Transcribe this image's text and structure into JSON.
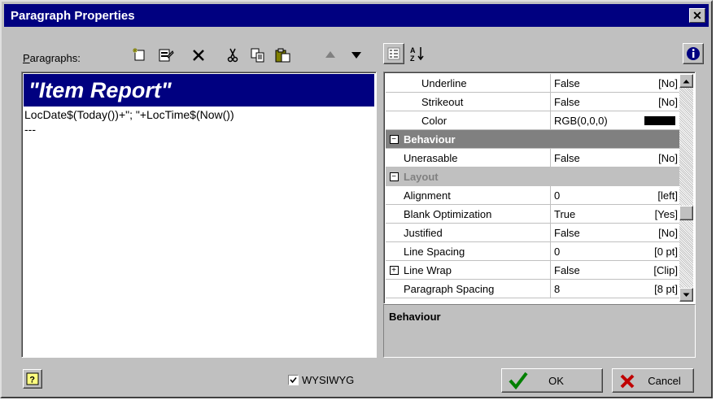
{
  "window": {
    "title": "Paragraph Properties",
    "close_glyph": "✕"
  },
  "paragraphs": {
    "label_prefix": "",
    "label_accel": "P",
    "label_rest": "aragraphs:",
    "items": [
      {
        "text": "\"Item Report\"",
        "selected": true
      },
      {
        "text": "LocDate$(Today())+\"; \"+LocTime$(Now())",
        "selected": false
      },
      {
        "text": "---",
        "selected": false
      }
    ]
  },
  "toolbar": {
    "icons": [
      "new-paragraph-icon",
      "properties-icon",
      "delete-icon",
      "cut-icon",
      "copy-icon",
      "paste-icon",
      "move-up-icon",
      "move-down-icon"
    ],
    "grid_icons": [
      "categorized-view-icon",
      "sort-alphabetical-icon",
      "info-icon"
    ]
  },
  "properties": {
    "rows": [
      {
        "kind": "prop",
        "name": "Underline",
        "value": "False",
        "extra": "[No]"
      },
      {
        "kind": "prop",
        "name": "Strikeout",
        "value": "False",
        "extra": "[No]"
      },
      {
        "kind": "prop",
        "name": "Color",
        "value": "RGB(0,0,0)",
        "extra": "",
        "swatch": "#000000"
      },
      {
        "kind": "category",
        "name": "Behaviour",
        "style": "dark",
        "expander": "⊟"
      },
      {
        "kind": "prop",
        "name": "Unerasable",
        "value": "False",
        "extra": "[No]"
      },
      {
        "kind": "category",
        "name": "Layout",
        "style": "light",
        "expander": "⊟"
      },
      {
        "kind": "prop",
        "name": "Alignment",
        "value": "0",
        "extra": "[left]"
      },
      {
        "kind": "prop",
        "name": "Blank Optimization",
        "value": "True",
        "extra": "[Yes]"
      },
      {
        "kind": "prop",
        "name": "Justified",
        "value": "False",
        "extra": "[No]"
      },
      {
        "kind": "prop",
        "name": "Line Spacing",
        "value": "0",
        "extra": "[0 pt]"
      },
      {
        "kind": "prop",
        "name": "Line Wrap",
        "value": "False",
        "extra": "[Clip]",
        "expander": "⊞"
      },
      {
        "kind": "prop",
        "name": "Paragraph Spacing",
        "value": "8",
        "extra": "[8 pt]"
      }
    ],
    "description_title": "Behaviour"
  },
  "footer": {
    "help_icon": "help-icon",
    "wysiwyg_checked": true,
    "wysiwyg_label": "WYSIWYG",
    "ok_label": "OK",
    "cancel_label": "Cancel",
    "ok_icon_color": "#008000",
    "cancel_icon_color": "#c00000"
  },
  "colors": {
    "titlebar": "#000080",
    "selection": "#000080",
    "dialog": "#c0c0c0"
  }
}
